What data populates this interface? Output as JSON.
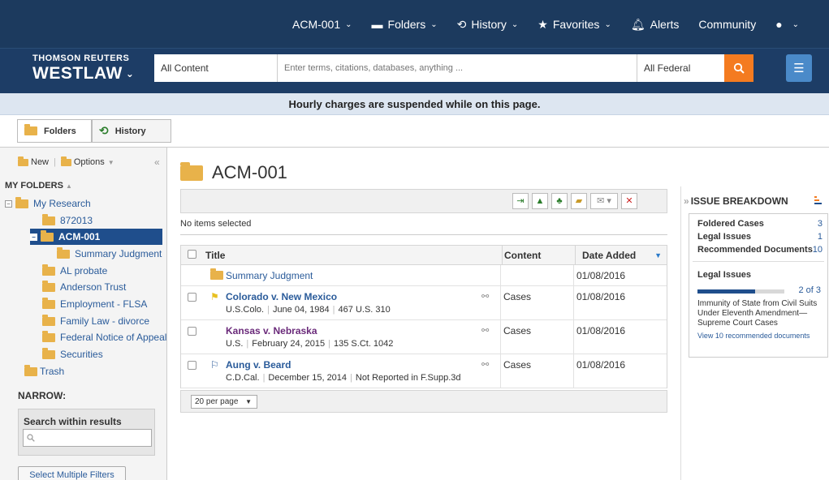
{
  "nav": {
    "client_id": "ACM-001",
    "folders": "Folders",
    "history": "History",
    "favorites": "Favorites",
    "alerts": "Alerts",
    "community": "Community"
  },
  "brand": {
    "line1": "THOMSON REUTERS",
    "line2": "WESTLAW"
  },
  "search": {
    "content_select": "All Content",
    "placeholder": "Enter terms, citations, databases, anything ...",
    "jurisdiction": "All Federal"
  },
  "notice": "Hourly charges are suspended while on this page.",
  "tabs": {
    "folders": "Folders",
    "history": "History"
  },
  "sidebar": {
    "new_label": "New",
    "options_label": "Options",
    "title": "MY FOLDERS",
    "tree": [
      {
        "label": "My Research"
      },
      {
        "label": "872013"
      },
      {
        "label": "ACM-001"
      },
      {
        "label": "Summary Judgment"
      },
      {
        "label": "AL probate"
      },
      {
        "label": "Anderson Trust"
      },
      {
        "label": "Employment - FLSA"
      },
      {
        "label": "Family Law - divorce"
      },
      {
        "label": "Federal Notice of Appeal"
      },
      {
        "label": "Securities"
      },
      {
        "label": "Trash"
      }
    ],
    "narrow": "NARROW:",
    "search_within_label": "Search within results",
    "select_filters": "Select Multiple Filters"
  },
  "main": {
    "folder_title": "ACM-001",
    "no_items": "No items selected",
    "columns": {
      "title": "Title",
      "content": "Content",
      "date": "Date Added"
    },
    "rows": [
      {
        "title": "Summary Judgment",
        "content": "",
        "date": "01/08/2016"
      },
      {
        "title": "Colorado v. New Mexico",
        "cite1": "U.S.Colo.",
        "cite2": "June 04, 1984",
        "cite3": "467 U.S. 310",
        "content": "Cases",
        "date": "01/08/2016"
      },
      {
        "title": "Kansas v. Nebraska",
        "cite1": "U.S.",
        "cite2": "February 24, 2015",
        "cite3": "135 S.Ct. 1042",
        "content": "Cases",
        "date": "01/08/2016"
      },
      {
        "title": "Aung v. Beard",
        "cite1": "C.D.Cal.",
        "cite2": "December 15, 2014",
        "cite3": "Not Reported in F.Supp.3d",
        "content": "Cases",
        "date": "01/08/2016"
      }
    ],
    "per_page": "20 per page"
  },
  "issue_breakdown": {
    "title": "ISSUE BREAKDOWN",
    "rows": [
      {
        "label": "Foldered Cases",
        "count": "3"
      },
      {
        "label": "Legal Issues",
        "count": "1"
      },
      {
        "label": "Recommended Documents",
        "count": "10"
      }
    ],
    "legal_issues_heading": "Legal Issues",
    "progress_fraction": 0.667,
    "progress_label": "2 of 3",
    "issue_desc": "Immunity of State from Civil Suits Under Eleventh Amendment—Supreme Court Cases",
    "view_link": "View 10 recommended documents"
  },
  "colors": {
    "nav_bg": "#1c3a5e",
    "brand_bg": "#1d3d66",
    "search_accent": "#f47b20",
    "selected_folder": "#1f4e8c",
    "link": "#2a5b9a"
  }
}
